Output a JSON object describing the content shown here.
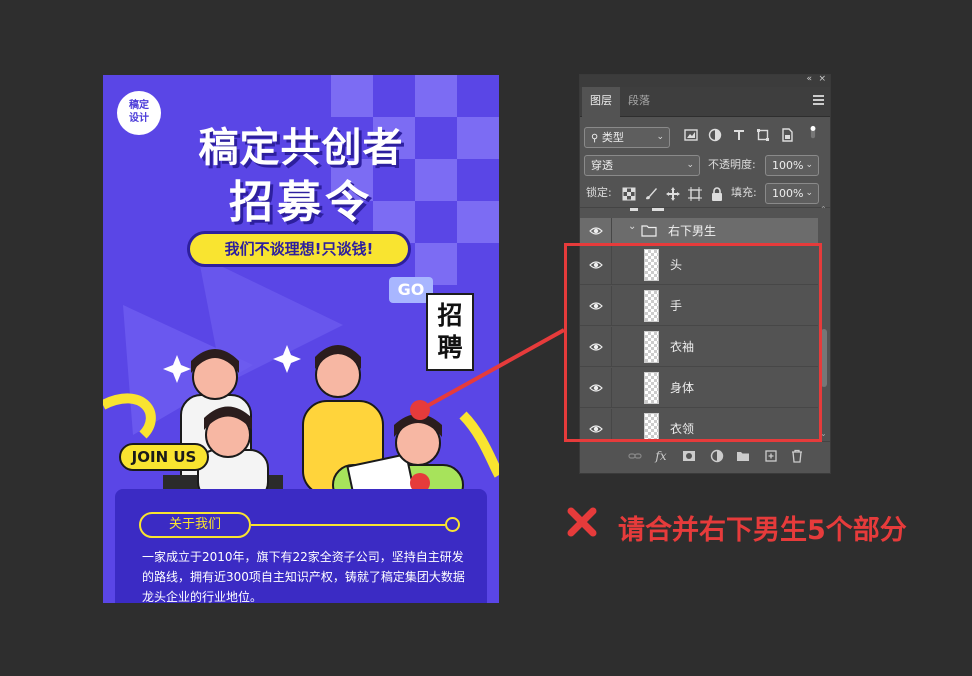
{
  "poster": {
    "logo_line1": "稿定",
    "logo_line2": "设计",
    "title_line1": "稿定共创者",
    "title_line2": "招募令",
    "slogan": "我们不谈理想!只谈钱!",
    "go_badge": "GO",
    "hire_line1": "招",
    "hire_line2": "聘",
    "join_badge": "JOIN US",
    "about_heading": "关于我们",
    "about_body": "一家成立于2010年，旗下有22家全资子公司，坚持自主研发的路线，拥有近300项自主知识产权，铸就了稿定集团大数据龙头企业的行业地位。",
    "colors": {
      "background": "#5a46e6",
      "accent": "#f9e430",
      "dark": "#2d1f9e"
    }
  },
  "layers_panel": {
    "collapse_icon": "«",
    "close_icon": "×",
    "tabs": [
      {
        "label": "图层"
      },
      {
        "label": "段落"
      }
    ],
    "filter": {
      "icon": "search-icon",
      "label": "类型"
    },
    "blend_mode": "穿透",
    "opacity_label": "不透明度:",
    "opacity_value": "100%",
    "lock_label": "锁定:",
    "fill_label": "填充:",
    "fill_value": "100%",
    "group": {
      "name": "右下男生",
      "expanded": true
    },
    "layers": [
      {
        "name": "头",
        "visible": true
      },
      {
        "name": "手",
        "visible": true
      },
      {
        "name": "衣袖",
        "visible": true
      },
      {
        "name": "身体",
        "visible": true
      },
      {
        "name": "衣领",
        "visible": true
      }
    ],
    "bottom_icons": [
      "link-icon",
      "fx-icon",
      "mask-icon",
      "adjustment-icon",
      "folder-icon",
      "new-layer-icon",
      "trash-icon"
    ],
    "fx_label": "fx"
  },
  "annotation": {
    "color": "#e63b3b",
    "message": "请合并右下男生5个部分"
  }
}
